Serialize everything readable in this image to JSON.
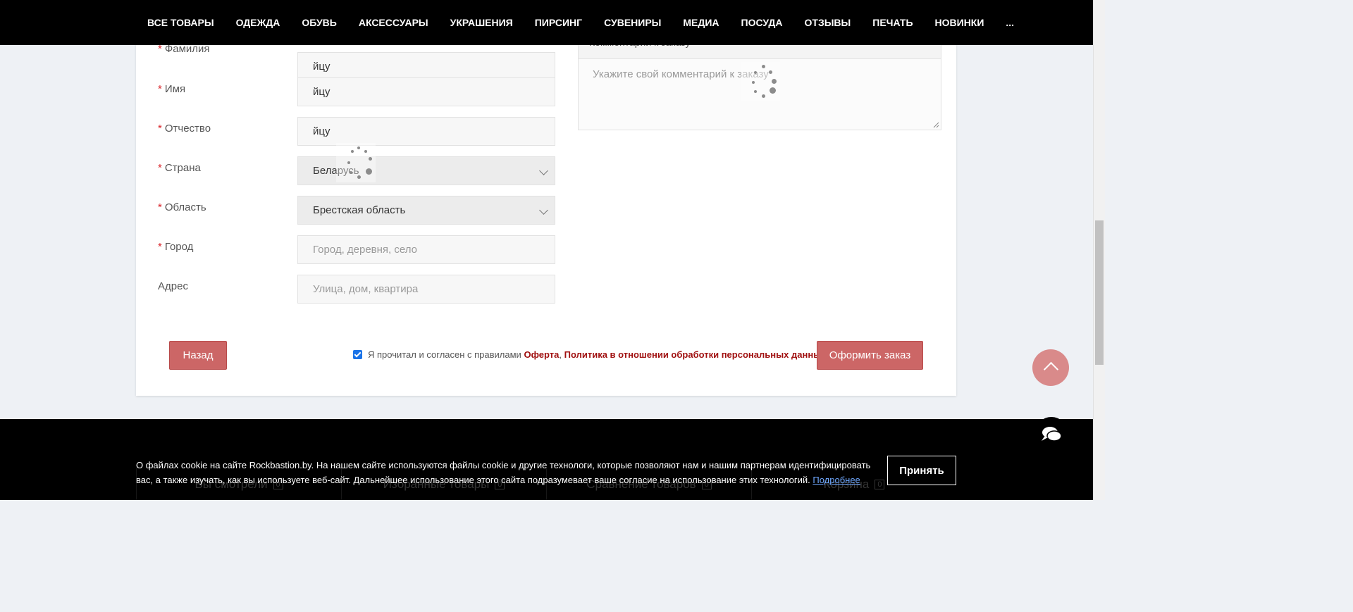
{
  "nav": {
    "items": [
      "ВСЕ ТОВАРЫ",
      "ОДЕЖДА",
      "ОБУВЬ",
      "АКСЕССУАРЫ",
      "УКРАШЕНИЯ",
      "ПИРСИНГ",
      "СУВЕНИРЫ",
      "МЕДИА",
      "ПОСУДА",
      "ОТЗЫВЫ",
      "ПЕЧАТЬ",
      "НОВИНКИ",
      "..."
    ]
  },
  "form": {
    "required_mark": "*",
    "surname": {
      "label": "Фамилия",
      "value": "йцу"
    },
    "name": {
      "label": "Имя",
      "value": "йцу"
    },
    "patronymic": {
      "label": "Отчество",
      "value": "йцу"
    },
    "country": {
      "label": "Страна",
      "value": "Беларусь"
    },
    "region": {
      "label": "Область",
      "value": "Брестская область"
    },
    "city": {
      "label": "Город",
      "placeholder": "Город, деревня, село"
    },
    "address": {
      "label": "Адрес",
      "placeholder": "Улица, дом, квартира"
    }
  },
  "comment": {
    "header": "Комментарий к заказу",
    "placeholder": "Укажите свой комментарий к заказу"
  },
  "actions": {
    "back": "Назад",
    "agree_text": "Я прочитал и согласен с правилами",
    "offer_link": "Оферта",
    "separator": ",",
    "privacy_link": "Политика в отношении обработки персональных данных",
    "submit": "Оформить заказ",
    "agree_checked": true
  },
  "footer_bar": {
    "items": [
      {
        "label": "Вы смотрели",
        "count": "0"
      },
      {
        "label": "Избранные товары",
        "count": "0"
      },
      {
        "label": "Сравнение товаров",
        "count": "0"
      },
      {
        "label": "Корзина",
        "count": "0"
      }
    ]
  },
  "cookie": {
    "text": "О файлах cookie на сайте Rockbastion.by. На нашем сайте используются файлы cookie и другие технологи, которые позволяют нам и нашим партнерам идентифицировать вас, а также изучать, как вы используете веб-сайт. Дальнейшее использование этого сайта подразумевает ваше согласие на использование этих технологий.",
    "link": "Подробнее",
    "accept": "Принять"
  },
  "colors": {
    "accent": "#cc6666",
    "link_red": "#a01010",
    "nav_bg": "#000000",
    "required": "#d9262c"
  }
}
